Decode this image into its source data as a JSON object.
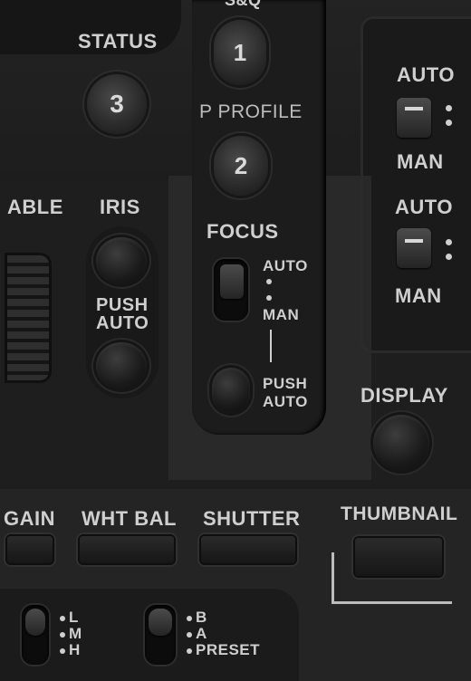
{
  "top_partial_label": "S&Q",
  "buttons": {
    "status_label": "STATUS",
    "status_number": "3",
    "sq_number": "1",
    "p_profile_label": "P PROFILE",
    "p_profile_number": "2",
    "able_label": "ABLE",
    "iris_label": "IRIS",
    "iris_push_auto": [
      "PUSH",
      "AUTO"
    ],
    "display_label": "DISPLAY",
    "thumbnail_label": "THUMBNAIL"
  },
  "focus": {
    "label": "FOCUS",
    "auto": "AUTO",
    "man": "MAN",
    "push_auto": [
      "PUSH",
      "AUTO"
    ]
  },
  "right_switches": [
    {
      "auto": "AUTO",
      "man": "MAN"
    },
    {
      "auto": "AUTO",
      "man": "MAN"
    }
  ],
  "bottom_row": {
    "gain": "GAIN",
    "wht_bal": "WHT BAL",
    "shutter": "SHUTTER"
  },
  "gain_switch": [
    "L",
    "M",
    "H"
  ],
  "wb_switch": [
    "B",
    "A",
    "PRESET"
  ]
}
